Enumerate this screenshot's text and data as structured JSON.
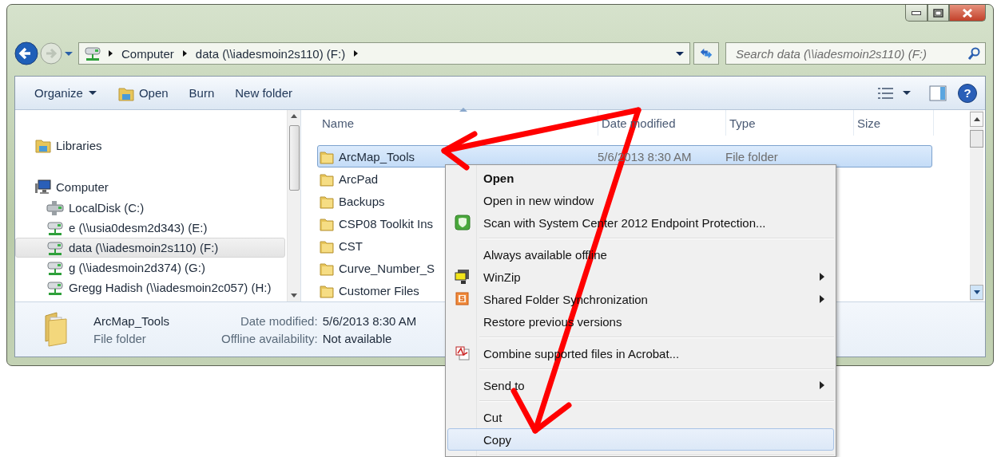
{
  "window": {
    "caption_buttons": [
      {
        "kind": "minimize"
      },
      {
        "kind": "maximize"
      },
      {
        "kind": "close"
      }
    ]
  },
  "address_bar": {
    "crumbs": [
      "Computer",
      "data (\\\\iadesmoin2s110) (F:)"
    ]
  },
  "search": {
    "placeholder": "Search data (\\\\iadesmoin2s110) (F:)"
  },
  "toolbar": {
    "buttons": [
      {
        "label": "Organize",
        "kind": "dropdown"
      },
      {
        "label": "Open",
        "kind": "folder"
      },
      {
        "label": "Burn",
        "kind": "plain"
      },
      {
        "label": "New folder",
        "kind": "plain"
      }
    ],
    "help": "?"
  },
  "navigation": [
    {
      "label": "Libraries",
      "kind": "libraries",
      "selected": false
    },
    {
      "label": "Computer",
      "kind": "computer",
      "selected": false,
      "children": [
        {
          "label": "LocalDisk (C:)",
          "kind": "disk",
          "selected": false
        },
        {
          "label": "e (\\\\usia0desm2d343) (E:)",
          "kind": "network",
          "selected": false
        },
        {
          "label": "data (\\\\iadesmoin2s110) (F:)",
          "kind": "network",
          "selected": true
        },
        {
          "label": "g (\\\\iadesmoin2d374) (G:)",
          "kind": "network",
          "selected": false
        },
        {
          "label": "Gregg Hadish (\\\\iadesmoin2c057) (H:)",
          "kind": "network",
          "selected": false
        }
      ]
    }
  ],
  "file_list": {
    "columns": [
      {
        "label": "Name",
        "sorted": true
      },
      {
        "label": "Date modified",
        "sorted": false
      },
      {
        "label": "Type",
        "sorted": false
      },
      {
        "label": "Size",
        "sorted": false
      }
    ],
    "rows": [
      {
        "name": "ArcMap_Tools",
        "date": "5/6/2013 8:30 AM",
        "type": "File folder",
        "selected": true
      },
      {
        "name": "ArcPad",
        "selected": false
      },
      {
        "name": "Backups",
        "selected": false
      },
      {
        "name": "CSP08 Toolkit Ins",
        "selected": false
      },
      {
        "name": "CST",
        "selected": false
      },
      {
        "name": "Curve_Number_S",
        "selected": false
      },
      {
        "name": "Customer Files",
        "selected": false
      }
    ]
  },
  "details_pane": {
    "name": "ArcMap_Tools",
    "type": "File folder",
    "fields": [
      {
        "label": "Date modified:",
        "value": "5/6/2013 8:30 AM"
      },
      {
        "label": "Offline availability:",
        "value": "Not available"
      }
    ]
  },
  "context_menu": {
    "items": [
      {
        "kind": "plain",
        "label": "Open",
        "bold": true,
        "submenu": false,
        "selected": false
      },
      {
        "kind": "plain",
        "label": "Open in new window",
        "bold": false,
        "submenu": false,
        "selected": false
      },
      {
        "kind": "shield",
        "label": "Scan with System Center 2012 Endpoint Protection...",
        "bold": false,
        "submenu": false,
        "selected": false
      },
      {
        "kind": "separator"
      },
      {
        "kind": "plain",
        "label": "Always available offline",
        "bold": false,
        "submenu": false,
        "selected": false
      },
      {
        "kind": "winzip",
        "label": "WinZip",
        "bold": false,
        "submenu": true,
        "selected": false
      },
      {
        "kind": "sync",
        "label": "Shared Folder Synchronization",
        "bold": false,
        "submenu": true,
        "selected": false
      },
      {
        "kind": "plain",
        "label": "Restore previous versions",
        "bold": false,
        "submenu": false,
        "selected": false
      },
      {
        "kind": "separator"
      },
      {
        "kind": "acrobat",
        "label": "Combine supported files in Acrobat...",
        "bold": false,
        "submenu": false,
        "selected": false
      },
      {
        "kind": "separator"
      },
      {
        "kind": "plain",
        "label": "Send to",
        "bold": false,
        "submenu": true,
        "selected": false
      },
      {
        "kind": "separator"
      },
      {
        "kind": "plain",
        "label": "Cut",
        "bold": false,
        "submenu": false,
        "selected": false
      },
      {
        "kind": "plain",
        "label": "Copy",
        "bold": false,
        "submenu": false,
        "selected": true
      },
      {
        "kind": "separator"
      }
    ]
  }
}
